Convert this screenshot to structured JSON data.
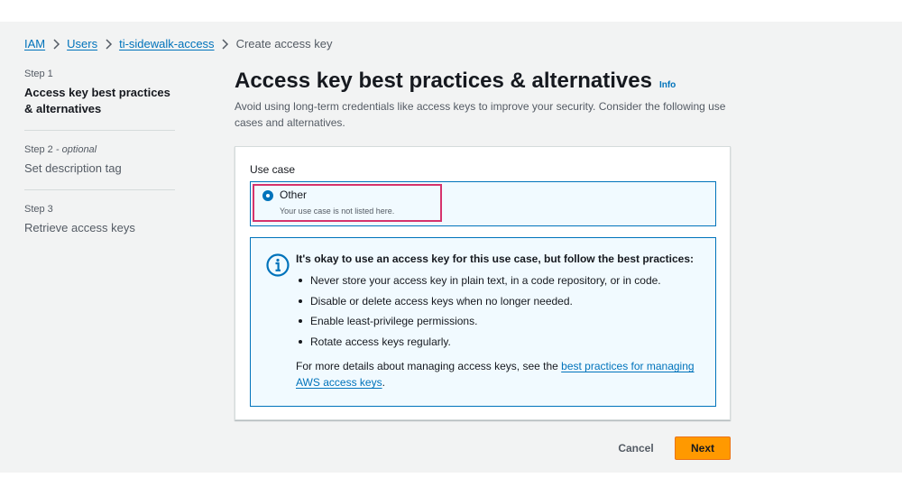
{
  "breadcrumb": {
    "items": [
      {
        "label": "IAM"
      },
      {
        "label": "Users"
      },
      {
        "label": "ti-sidewalk-access"
      }
    ],
    "current": "Create access key",
    "separator_icon": "chevron-right-icon"
  },
  "steps": [
    {
      "number": "Step 1",
      "optional": "",
      "title": "Access key best practices & alternatives"
    },
    {
      "number": "Step 2",
      "optional": " - optional",
      "title": "Set description tag"
    },
    {
      "number": "Step 3",
      "optional": "",
      "title": "Retrieve access keys"
    }
  ],
  "page": {
    "title": "Access key best practices & alternatives",
    "info": "Info",
    "description": "Avoid using long-term credentials like access keys to improve your security. Consider the following use cases and alternatives."
  },
  "use_case": {
    "label": "Use case",
    "option_title": "Other",
    "option_subtitle": "Your use case is not listed here.",
    "selected": true
  },
  "alert": {
    "icon": "info-circle-icon",
    "heading": "It's okay to use an access key for this use case, but follow the best practices:",
    "bullets": [
      "Never store your access key in plain text, in a code repository, or in code.",
      "Disable or delete access keys when no longer needed.",
      "Enable least-privilege permissions.",
      "Rotate access keys regularly."
    ],
    "more_prefix": "For more details about managing access keys, see the ",
    "more_link": "best practices for managing AWS access keys",
    "more_suffix": "."
  },
  "actions": {
    "cancel": "Cancel",
    "next": "Next"
  },
  "colors": {
    "link": "#0073bb",
    "primary_button": "#ff9900",
    "highlight": "#d6336c",
    "background": "#f2f3f3"
  }
}
